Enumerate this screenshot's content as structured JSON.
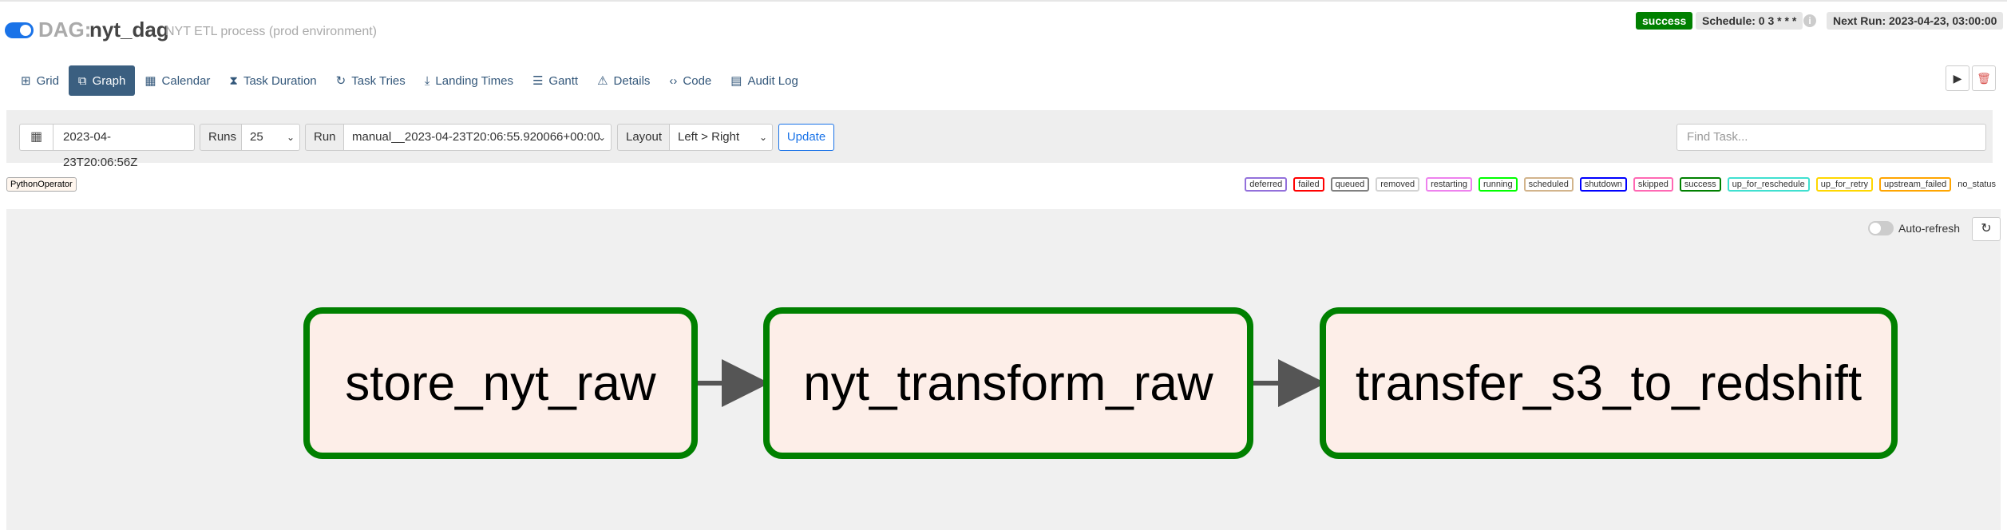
{
  "header": {
    "dag_prefix": "DAG:",
    "dag_id": "nyt_dag",
    "description": "NYT ETL process (prod environment)",
    "status": "success",
    "schedule": "Schedule: 0 3 * * *",
    "info_icon": "i",
    "next_run": "Next Run: 2023-04-23, 03:00:00"
  },
  "tabs": [
    {
      "label": "Grid",
      "icon": "⊞"
    },
    {
      "label": "Graph",
      "icon": "⧉"
    },
    {
      "label": "Calendar",
      "icon": "▦"
    },
    {
      "label": "Task Duration",
      "icon": "⧗"
    },
    {
      "label": "Task Tries",
      "icon": "↻"
    },
    {
      "label": "Landing Times",
      "icon": "⤓"
    },
    {
      "label": "Gantt",
      "icon": "☰"
    },
    {
      "label": "Details",
      "icon": "⚠"
    },
    {
      "label": "Code",
      "icon": "‹›"
    },
    {
      "label": "Audit Log",
      "icon": "▤"
    }
  ],
  "toolbar": {
    "date": "2023-04-23T20:06:56Z",
    "runs_label": "Runs",
    "runs_value": "25",
    "run_label": "Run",
    "run_value": "manual__2023-04-23T20:06:55.920066+00:00",
    "layout_label": "Layout",
    "layout_value": "Left > Right",
    "update_label": "Update",
    "find_placeholder": "Find Task..."
  },
  "operator": "PythonOperator",
  "legend": [
    {
      "label": "deferred",
      "color": "#9370db"
    },
    {
      "label": "failed",
      "color": "#ff0000"
    },
    {
      "label": "queued",
      "color": "#808080"
    },
    {
      "label": "removed",
      "color": "#d3d3d3"
    },
    {
      "label": "restarting",
      "color": "#ee82ee"
    },
    {
      "label": "running",
      "color": "#00ff00"
    },
    {
      "label": "scheduled",
      "color": "#d2b48c"
    },
    {
      "label": "shutdown",
      "color": "#0000ff"
    },
    {
      "label": "skipped",
      "color": "#ff69b4"
    },
    {
      "label": "success",
      "color": "#008000"
    },
    {
      "label": "up_for_reschedule",
      "color": "#40e0d0"
    },
    {
      "label": "up_for_retry",
      "color": "#ffd700"
    },
    {
      "label": "upstream_failed",
      "color": "#ffa500"
    }
  ],
  "legend_no_status": "no_status",
  "graph": {
    "auto_refresh_label": "Auto-refresh",
    "tasks": [
      "store_nyt_raw",
      "nyt_transform_raw",
      "transfer_s3_to_redshift"
    ]
  },
  "colors": {
    "primary": "#1a73e8",
    "nav_active": "#3b5f80",
    "success": "#008000",
    "node_fill": "#fdeee8"
  }
}
